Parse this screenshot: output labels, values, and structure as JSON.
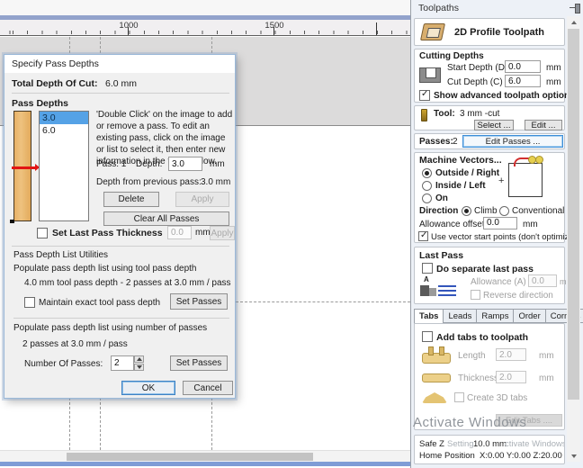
{
  "colors": {
    "accent_blue": "#3e8ed8",
    "selection_blue": "#55a2e6",
    "wood": "#e3af62",
    "marker_red": "#e21414",
    "ruler_bar": "#93a3cc"
  },
  "units": {
    "mm": "mm"
  },
  "ruler": {
    "label_1000": "1000",
    "label_1500": "1500"
  },
  "dialog": {
    "title": "Specify Pass Depths",
    "total_depth_label": "Total Depth Of Cut:",
    "total_depth_value": "6.0 mm",
    "pass_depths_label": "Pass Depths",
    "list_items": [
      "3.0",
      "6.0"
    ],
    "instructions": "'Double Click' on the image to add or remove a pass. To edit an existing pass, click on the image or list to select it, then enter new information in the fields below.",
    "pass_label": "Pass: 1",
    "depth_label": "Depth:",
    "depth_value": "3.0",
    "prev_pass_label": "Depth from previous pass:",
    "prev_pass_value": "3.0 mm",
    "delete_button": "Delete",
    "apply_button": "Apply",
    "clear_all_button": "Clear All Passes",
    "set_last_pass_label": "Set Last Pass Thickness",
    "set_last_pass_value": "0.0",
    "utilities": {
      "title": "Pass Depth List Utilities",
      "tool_pass_label": "Populate pass depth list using tool pass depth",
      "tool_pass_summary": "4.0 mm tool pass depth - 2 passes at 3.0 mm / pass",
      "maintain_label": "Maintain exact tool pass depth",
      "set_passes_button": "Set Passes",
      "num_pass_label": "Populate pass depth list using number of passes",
      "num_pass_summary": "2 passes at 3.0 mm / pass",
      "number_of_passes_label": "Number Of Passes:",
      "number_of_passes_value": "2"
    },
    "ok_button": "OK",
    "cancel_button": "Cancel"
  },
  "panel": {
    "title": "Toolpaths",
    "toolpath_header": "2D Profile Toolpath",
    "cutting_depths": {
      "title": "Cutting Depths",
      "start_depth_label": "Start Depth (D)",
      "start_depth_value": "0.0",
      "cut_depth_label": "Cut Depth (C)",
      "cut_depth_value": "6.0"
    },
    "advanced_options_label": "Show advanced toolpath options",
    "tool": {
      "label": "Tool:",
      "name": "3 mm -cut",
      "select_button": "Select ...",
      "edit_button": "Edit ..."
    },
    "passes": {
      "label": "Passes:",
      "value": "2",
      "edit_passes_button": "Edit Passes ..."
    },
    "machine_vectors": {
      "title": "Machine Vectors...",
      "options": [
        "Outside / Right",
        "Inside / Left",
        "On"
      ],
      "direction_label": "Direction",
      "climb_label": "Climb",
      "conventional_label": "Conventional",
      "allowance_label": "Allowance offset",
      "allowance_value": "0.0",
      "vector_start_label": "Use vector start points (don't optimize)"
    },
    "last_pass": {
      "title": "Last Pass",
      "separate_label": "Do separate last pass",
      "allowance_label": "Allowance (A)",
      "allowance_value": "0.0",
      "reverse_label": "Reverse direction"
    },
    "tabs_bar": [
      "Tabs",
      "Leads",
      "Ramps",
      "Order",
      "Corners"
    ],
    "tabs_tab": {
      "add_label": "Add tabs to toolpath",
      "length_label": "Length",
      "length_value": "2.0",
      "thickness_label": "Thickness",
      "thickness_value": "2.0",
      "create3d_label": "Create 3D tabs",
      "edit_tabs_button": "Edit Tabs ...."
    },
    "watermark": {
      "line1": "Activate Windows",
      "mid": "Setting",
      "end": "ctivate Windows."
    },
    "footer": {
      "safe_z_label": "Safe Z",
      "safe_z_value": "10.0 mm",
      "home_label": "Home Position",
      "home_value": "X:0.00 Y:0.00 Z:20.00"
    }
  }
}
